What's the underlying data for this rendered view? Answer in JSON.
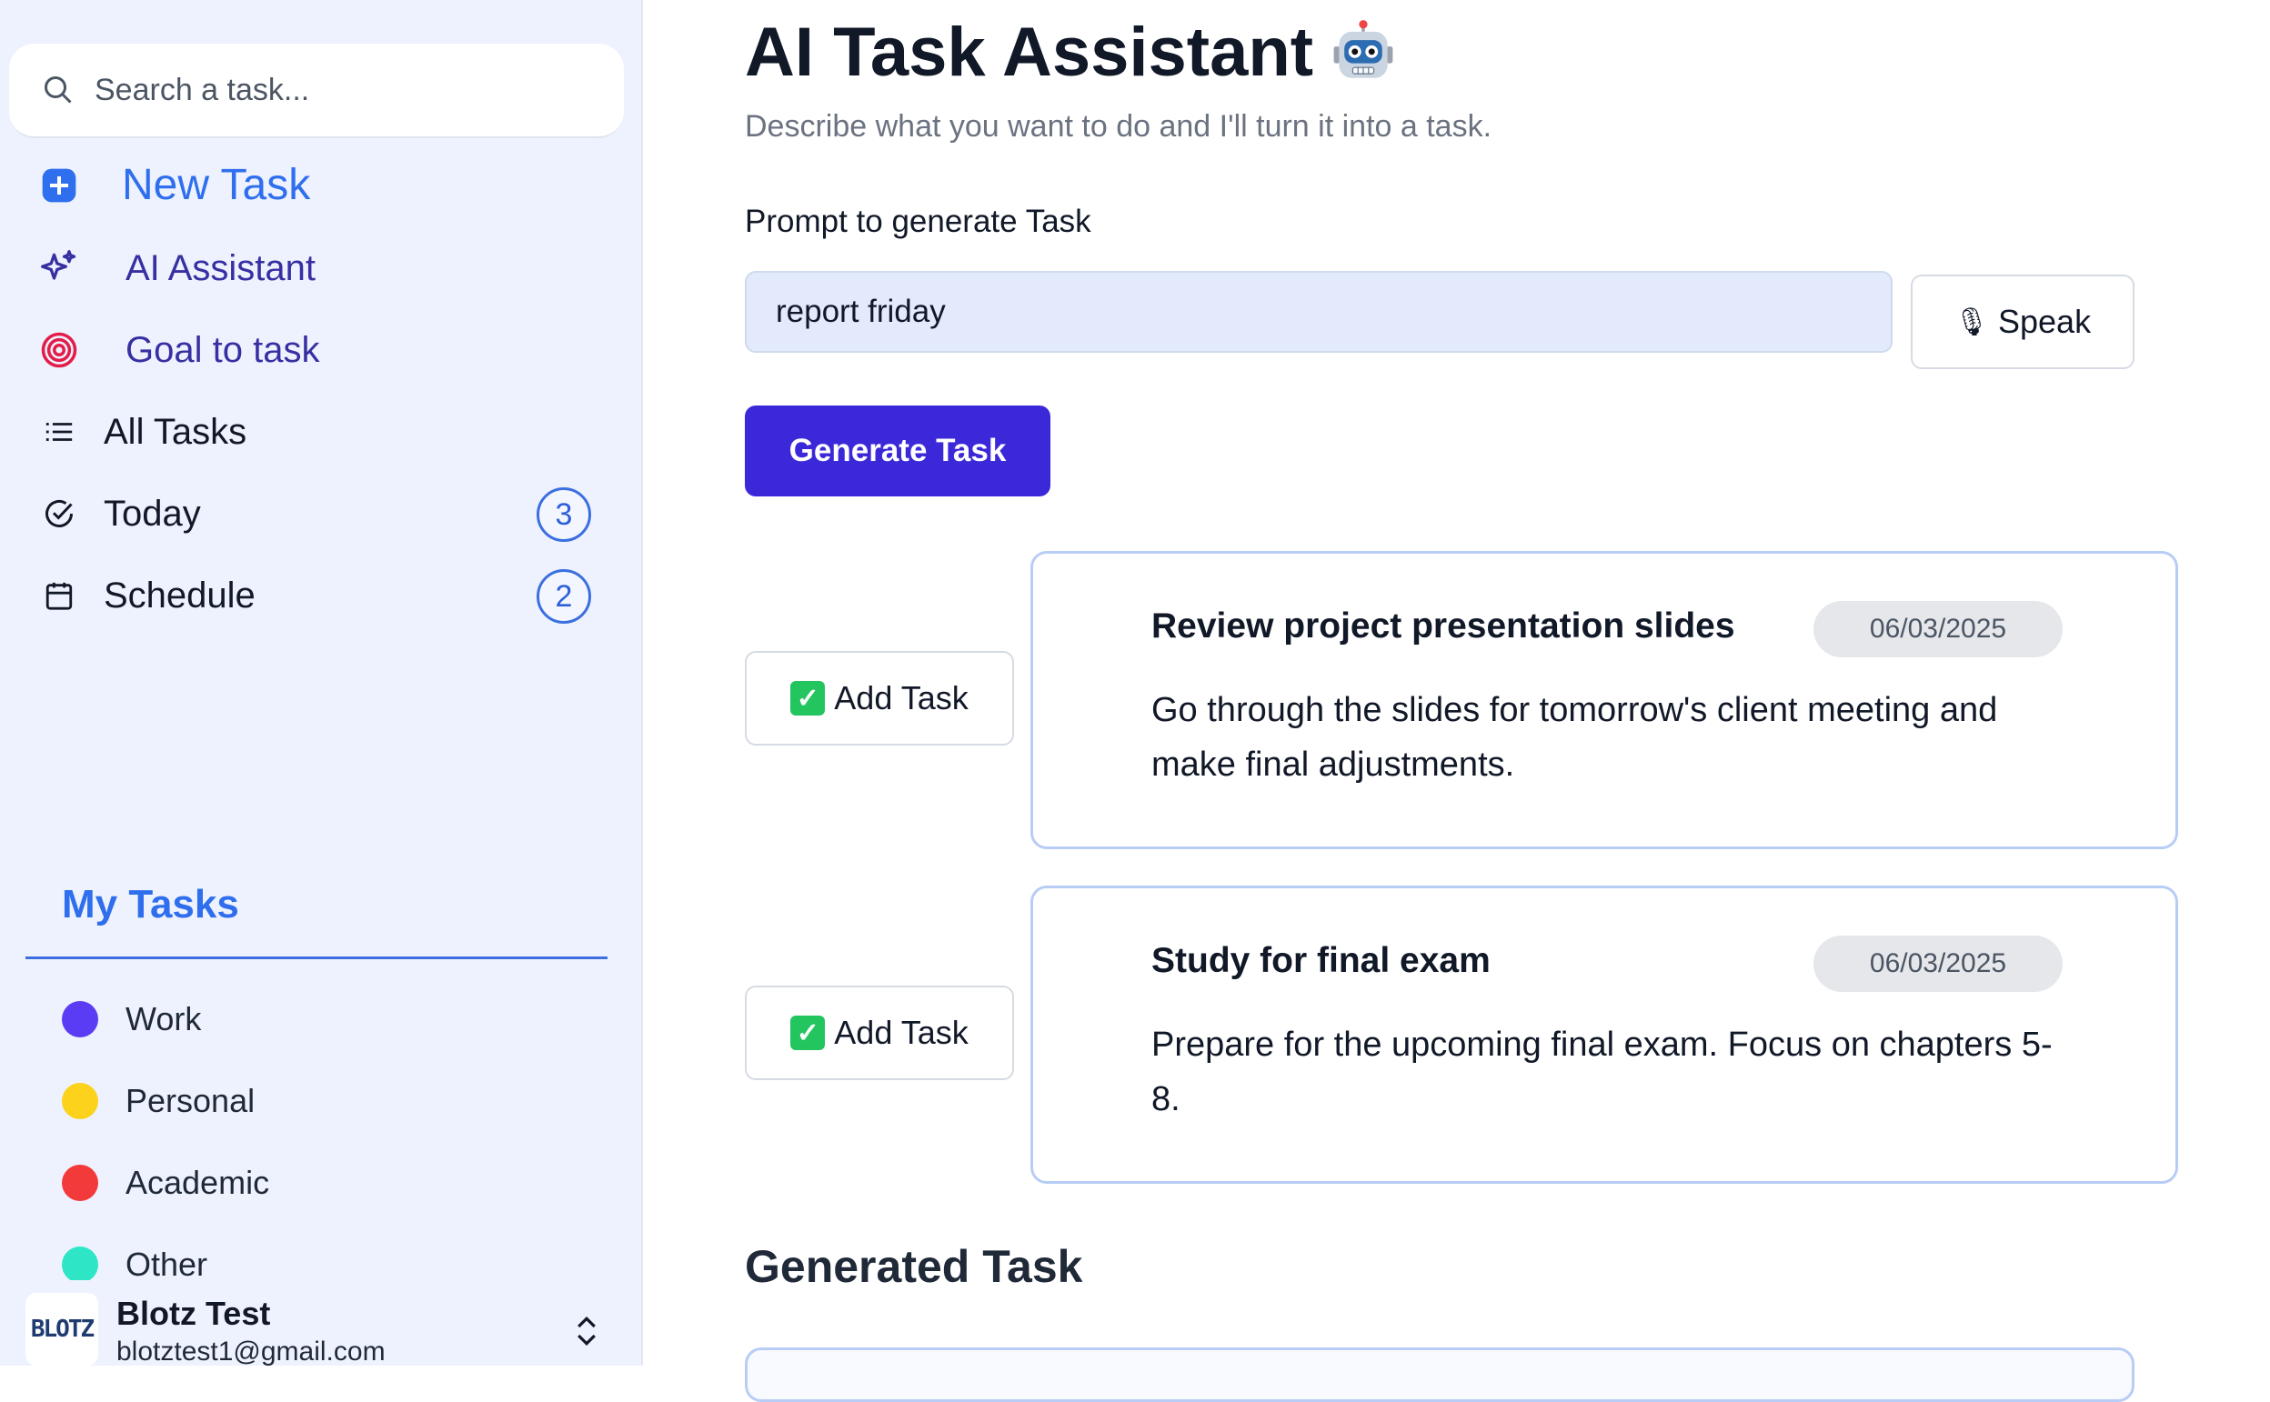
{
  "sidebar": {
    "search": {
      "placeholder": "Search a task..."
    },
    "nav": {
      "new_task": "New Task",
      "ai_assistant": "AI Assistant",
      "goal_to_task": "Goal to task",
      "all_tasks": "All Tasks",
      "today": "Today",
      "today_count": "3",
      "schedule": "Schedule",
      "schedule_count": "2"
    },
    "my_tasks": {
      "title": "My Tasks",
      "categories": [
        {
          "label": "Work",
          "color": "#5b3cf5"
        },
        {
          "label": "Personal",
          "color": "#fcd21c"
        },
        {
          "label": "Academic",
          "color": "#f23a3a"
        },
        {
          "label": "Other",
          "color": "#2ee6c6"
        }
      ]
    },
    "user": {
      "avatar_text": "BLOTZ",
      "name": "Blotz Test",
      "email": "blotztest1@gmail.com"
    }
  },
  "main": {
    "title": "AI Task Assistant",
    "subtitle": "Describe what you want to do and I'll turn it into a task.",
    "prompt_label": "Prompt to generate Task",
    "prompt_value": "report friday",
    "speak_label": "Speak",
    "generate_label": "Generate Task",
    "add_task_label": "Add Task",
    "suggestions": [
      {
        "title": "Review project presentation slides",
        "date": "06/03/2025",
        "description": "Go through the slides for tomorrow's client meeting and make final adjustments."
      },
      {
        "title": "Study for final exam",
        "date": "06/03/2025",
        "description": "Prepare for the upcoming final exam. Focus on chapters 5-8."
      }
    ],
    "generated_heading": "Generated Task"
  },
  "colors": {
    "sidebar_bg": "#eef2fe",
    "accent_blue": "#2f6fee",
    "primary_button": "#3b28d8",
    "card_border": "#b7cdf5"
  }
}
